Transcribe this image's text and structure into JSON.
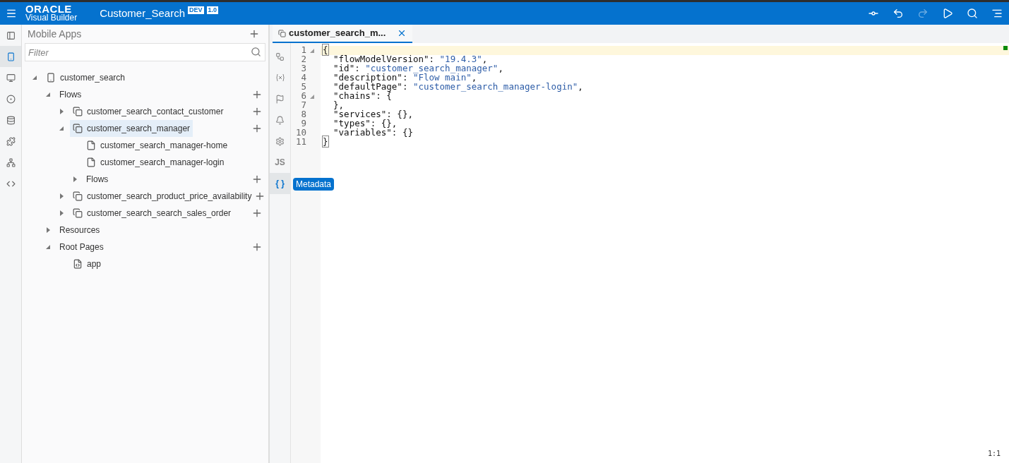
{
  "header": {
    "logo_top": "ORACLE",
    "logo_bottom": "Visual Builder",
    "app_name": "Customer_Search",
    "badges": [
      "DEV",
      "1.0"
    ]
  },
  "toolbar": [
    {
      "kind": "git",
      "disabled": false
    },
    {
      "kind": "undo",
      "disabled": false
    },
    {
      "kind": "redo",
      "disabled": true
    },
    {
      "kind": "run",
      "disabled": false
    },
    {
      "kind": "search",
      "disabled": false
    },
    {
      "kind": "menu",
      "disabled": false
    }
  ],
  "nav_rail": [
    {
      "kind": "collapse",
      "selected": false
    },
    {
      "kind": "mobile",
      "selected": true
    },
    {
      "kind": "web",
      "selected": false
    },
    {
      "kind": "services",
      "selected": false
    },
    {
      "kind": "data",
      "selected": false
    },
    {
      "kind": "components",
      "selected": false
    },
    {
      "kind": "processes",
      "selected": false
    },
    {
      "kind": "source",
      "selected": false
    }
  ],
  "navigator": {
    "title": "Mobile Apps",
    "filter": {
      "placeholder": "Filter"
    },
    "tree": [
      {
        "label": "customer_search",
        "kind": "mobile",
        "expanded": true,
        "selected": false,
        "add": false,
        "children": [
          {
            "label": "Flows",
            "expanded": true,
            "selected": false,
            "add": true,
            "children": [
              {
                "label": "customer_search_contact_customer",
                "kind": "flow",
                "expanded": false,
                "selected": false,
                "add": true
              },
              {
                "label": "customer_search_manager",
                "kind": "flow",
                "expanded": true,
                "selected": true,
                "add": true,
                "children": [
                  {
                    "label": "customer_search_manager-home",
                    "kind": "page",
                    "selected": false,
                    "add": false
                  },
                  {
                    "label": "customer_search_manager-login",
                    "kind": "page",
                    "selected": false,
                    "add": false
                  },
                  {
                    "label": "Flows",
                    "expanded": false,
                    "selected": false,
                    "add": true
                  }
                ]
              },
              {
                "label": "customer_search_product_price_availability",
                "kind": "flow",
                "expanded": false,
                "selected": false,
                "add": true
              },
              {
                "label": "customer_search_search_sales_order",
                "kind": "flow",
                "expanded": false,
                "selected": false,
                "add": true
              }
            ]
          },
          {
            "label": "Resources",
            "expanded": false,
            "selected": false,
            "add": false
          },
          {
            "label": "Root Pages",
            "expanded": true,
            "selected": false,
            "add": true,
            "children": [
              {
                "label": "app",
                "kind": "shell",
                "selected": false,
                "add": false
              }
            ]
          }
        ]
      }
    ]
  },
  "editor": {
    "tab": {
      "label": "customer_search_m...",
      "selected": true
    },
    "rail": [
      {
        "kind": "diagram",
        "selected": false
      },
      {
        "kind": "variables",
        "selected": false
      },
      {
        "kind": "events",
        "selected": false
      },
      {
        "kind": "notifications",
        "selected": false
      },
      {
        "kind": "settings",
        "selected": false
      },
      {
        "kind": "text",
        "label": "JS",
        "selected": false
      },
      {
        "kind": "text",
        "label": "{ }",
        "selected": true,
        "tooltip": "Metadata"
      }
    ],
    "lines": [
      {
        "number": "1",
        "fold": true,
        "current": true,
        "tokens": [
          {
            "kind": "match",
            "text": "{"
          }
        ]
      },
      {
        "number": "2",
        "fold": false,
        "current": false,
        "tokens": [
          {
            "kind": "key",
            "text": "  \"flowModelVersion\": "
          },
          {
            "kind": "string",
            "text": "\"19.4.3\""
          },
          {
            "kind": "key",
            "text": ","
          }
        ]
      },
      {
        "number": "3",
        "fold": false,
        "current": false,
        "tokens": [
          {
            "kind": "key",
            "text": "  \"id\": "
          },
          {
            "kind": "string",
            "text": "\"customer_search_manager\""
          },
          {
            "kind": "key",
            "text": ","
          }
        ]
      },
      {
        "number": "4",
        "fold": false,
        "current": false,
        "tokens": [
          {
            "kind": "key",
            "text": "  \"description\": "
          },
          {
            "kind": "string",
            "text": "\"Flow main\""
          },
          {
            "kind": "key",
            "text": ","
          }
        ]
      },
      {
        "number": "5",
        "fold": false,
        "current": false,
        "tokens": [
          {
            "kind": "key",
            "text": "  \"defaultPage\": "
          },
          {
            "kind": "string",
            "text": "\"customer_search_manager-login\""
          },
          {
            "kind": "key",
            "text": ","
          }
        ]
      },
      {
        "number": "6",
        "fold": true,
        "current": false,
        "tokens": [
          {
            "kind": "key",
            "text": "  \"chains\": {"
          }
        ]
      },
      {
        "number": "7",
        "fold": false,
        "current": false,
        "tokens": [
          {
            "kind": "key",
            "text": "  },"
          }
        ]
      },
      {
        "number": "8",
        "fold": false,
        "current": false,
        "tokens": [
          {
            "kind": "key",
            "text": "  \"services\": {},"
          }
        ]
      },
      {
        "number": "9",
        "fold": false,
        "current": false,
        "tokens": [
          {
            "kind": "key",
            "text": "  \"types\": {},"
          }
        ]
      },
      {
        "number": "10",
        "fold": false,
        "current": false,
        "tokens": [
          {
            "kind": "key",
            "text": "  \"variables\": {}"
          }
        ]
      },
      {
        "number": "11",
        "fold": false,
        "current": false,
        "tokens": [
          {
            "kind": "match",
            "text": "}"
          }
        ]
      }
    ],
    "cursor_position": "1:1"
  }
}
